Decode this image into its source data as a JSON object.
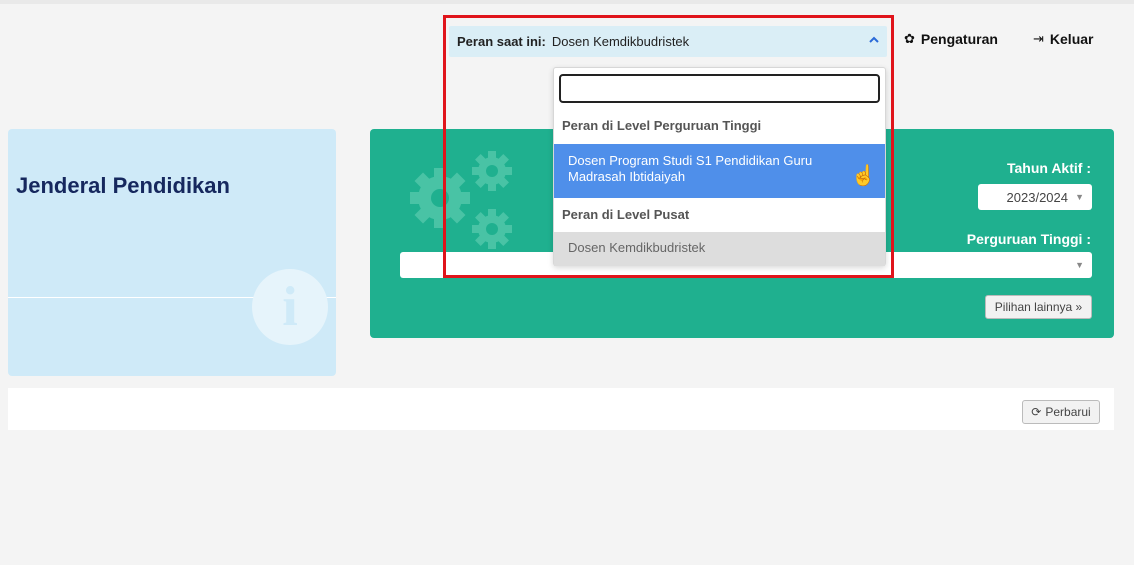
{
  "role_selector": {
    "label": "Peran saat ini:",
    "value": "Dosen Kemdikbudristek",
    "caret_icon": "chevron-up-icon"
  },
  "nav": {
    "settings": {
      "label": "Pengaturan",
      "icon": "gear-icon"
    },
    "logout": {
      "label": "Keluar",
      "icon": "logout-icon"
    }
  },
  "role_dropdown": {
    "search_value": "",
    "groups": [
      {
        "label": "Peran di Level Perguruan Tinggi",
        "options": [
          {
            "label": "Dosen Program Studi S1 Pendidikan Guru Madrasah Ibtidaiyah",
            "state": "hovered"
          }
        ]
      },
      {
        "label": "Peran di Level Pusat",
        "options": [
          {
            "label": "Dosen Kemdikbudristek",
            "state": "selected"
          }
        ]
      }
    ]
  },
  "info_panel": {
    "title": "Jenderal Pendidikan",
    "icon": "info-icon"
  },
  "filters": {
    "year_label": "Tahun Aktif :",
    "year_value": "2023/2024",
    "university_label": "Perguruan Tinggi :",
    "university_value": "",
    "more_label": "Pilihan lainnya »"
  },
  "toolbar": {
    "refresh_label": "Perbarui",
    "refresh_icon": "refresh-icon"
  },
  "colors": {
    "highlight": "#e0141b",
    "green_panel": "#1fb08f",
    "info_panel": "#cfeaf8",
    "option_hover": "#4f8fea"
  }
}
